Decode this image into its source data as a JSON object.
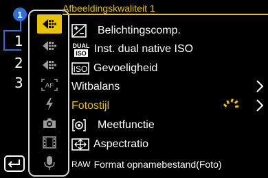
{
  "header": {
    "title": "Afbeeldingskwaliteit 1"
  },
  "pages": {
    "current_badge": "1",
    "numbers": [
      "1",
      "2",
      "3"
    ]
  },
  "tabs": [
    {
      "name": "photo-quality-1",
      "icon": "camera-quality-icon",
      "active": true
    },
    {
      "name": "photo-quality-2",
      "icon": "camera-quality-icon",
      "active": false
    },
    {
      "name": "photo-quality-3",
      "icon": "camera-quality-icon",
      "active": false
    },
    {
      "name": "autofocus",
      "icon": "af-icon",
      "active": false
    },
    {
      "name": "flash",
      "icon": "flash-icon",
      "active": false
    },
    {
      "name": "photo-others",
      "icon": "camera-icon",
      "active": false
    },
    {
      "name": "video",
      "icon": "film-icon",
      "active": false
    },
    {
      "name": "audio",
      "icon": "microphone-icon",
      "active": false
    }
  ],
  "menu": {
    "items": [
      {
        "label": "Belichtingscomp.",
        "icon": "exposure-comp-icon",
        "icon_text": ""
      },
      {
        "label": "Inst. dual native ISO",
        "icon": "dual-iso-icon",
        "icon_text": "DUAL\nISO"
      },
      {
        "label": "Gevoeligheid",
        "icon": "iso-icon",
        "icon_text": "ISO"
      },
      {
        "label": "Witbalans",
        "icon": "",
        "icon_text": ""
      },
      {
        "label": "Fotostijl",
        "icon": "",
        "icon_text": ""
      },
      {
        "label": "Meetfunctie",
        "icon": "metering-icon",
        "icon_text": ""
      },
      {
        "label": "Aspectratio",
        "icon": "aspect-ratio-icon",
        "icon_text": ""
      },
      {
        "label": "Format opnamebestand(Foto)",
        "icon": "raw-icon",
        "icon_text": "RAW"
      }
    ],
    "selected_index": 4
  },
  "colors": {
    "accent": "#e9c200",
    "badge": "#2f6fd6",
    "text": "#ffffff",
    "background": "#000000"
  }
}
